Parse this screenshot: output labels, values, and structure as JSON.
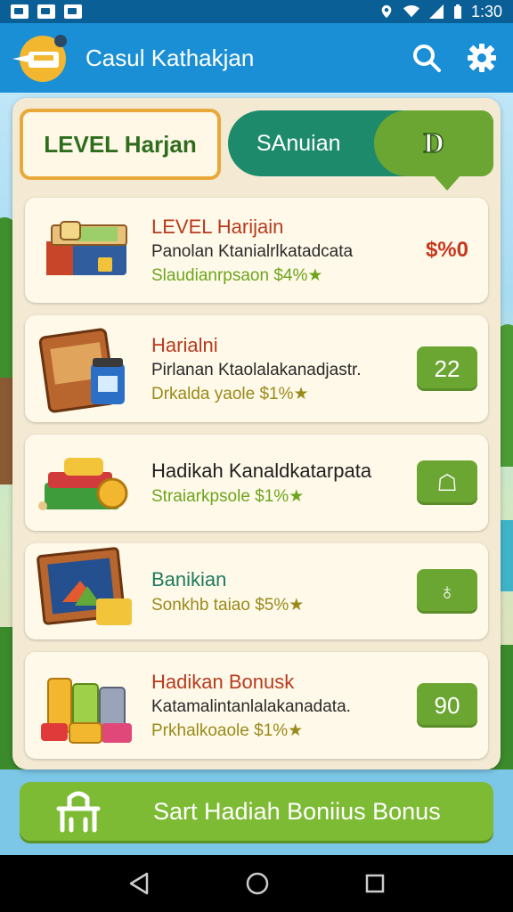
{
  "status_bar": {
    "time": "1:30"
  },
  "app_bar": {
    "title": "Casul Kathakjan"
  },
  "tabs": {
    "level_tab": "LEVEL Harjan",
    "second_tab": "SAnuian",
    "badge_glyph": "D"
  },
  "items": [
    {
      "title": "LEVEL Harijain",
      "desc": "Panolan Ktanialrlkatadcata",
      "reward": "Slaudianrpsaon $4%★",
      "price": "$%0",
      "title_color": "red"
    },
    {
      "title": "Harialni",
      "desc": "Pirlanan Ktaolalakanadjastr.",
      "reward": "Drkalda yaole $1%★",
      "pill": "22",
      "title_color": "red"
    },
    {
      "title": "Hadikah Kanaldkatarpata",
      "desc": "",
      "reward": "Straiarkpsole $1%★",
      "pill": "☖",
      "title_color": "dark"
    },
    {
      "title": "Banikian",
      "desc": "",
      "reward": "Sonkhb taiao $5%★",
      "pill": "♁",
      "title_color": "teal"
    },
    {
      "title": "Hadikan Bonusk",
      "desc": "Katamalintanlalakanadata.",
      "reward": "Prkhalkoaole $1%★",
      "pill": "90",
      "title_color": "red"
    }
  ],
  "cta": {
    "label": "Sart Hadiah Boniius Bonus"
  },
  "colors": {
    "appbar": "#1a8fd6",
    "accent_green": "#6ca632",
    "price_red": "#c7381e"
  },
  "icons": [
    "logo-icon",
    "search-icon",
    "gear-icon",
    "back-icon",
    "home-icon",
    "recents-icon",
    "gift-icon"
  ]
}
